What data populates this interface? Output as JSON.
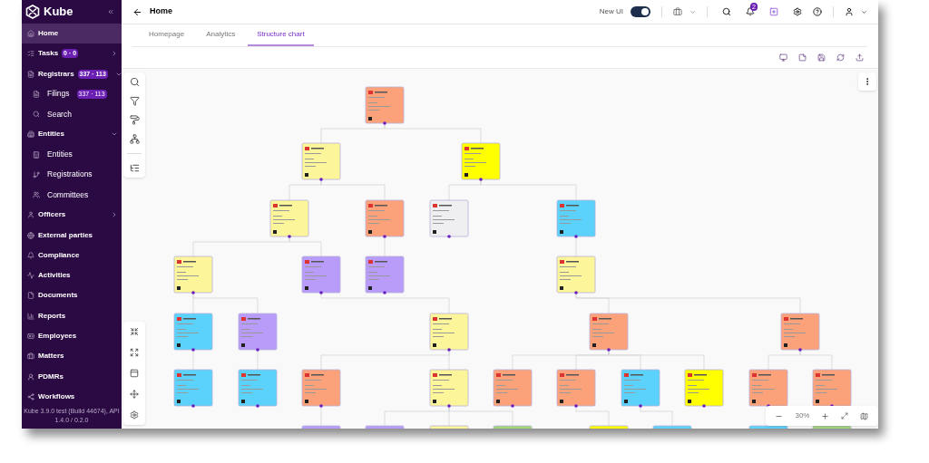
{
  "sidebar": {
    "logo": "Kube",
    "items": [
      {
        "label": "Home",
        "selected": true
      },
      {
        "label": "Tasks",
        "badge": "0 · 0",
        "expanded": false
      },
      {
        "label": "Registrars",
        "badge": "337 · 113",
        "expanded": true,
        "children": [
          {
            "label": "Filings",
            "badge": "337 · 113"
          },
          {
            "label": "Search"
          }
        ]
      },
      {
        "label": "Entities",
        "expanded": true,
        "children": [
          {
            "label": "Entities"
          },
          {
            "label": "Registrations"
          },
          {
            "label": "Committees"
          }
        ]
      },
      {
        "label": "Officers",
        "expanded": false
      },
      {
        "label": "External parties"
      },
      {
        "label": "Compliance"
      },
      {
        "label": "Activities"
      },
      {
        "label": "Documents"
      },
      {
        "label": "Reports"
      },
      {
        "label": "Employees"
      },
      {
        "label": "Matters"
      },
      {
        "label": "PDMRs"
      },
      {
        "label": "Workflows"
      }
    ],
    "footer": "Kube 3.9.0 test (Build 44674), API 1.4.0 / 0.2.0"
  },
  "header": {
    "title": "Home",
    "new_ui": {
      "label": "New UI",
      "on": true
    },
    "notification_count": "2"
  },
  "tabs": [
    {
      "label": "Homepage",
      "selected": false
    },
    {
      "label": "Analytics",
      "selected": false
    },
    {
      "label": "Structure chart",
      "selected": true
    }
  ],
  "chart": {
    "zoom": "30%",
    "nodes": [
      {
        "color": "#fca27a"
      },
      {
        "color": "#fdf59a"
      },
      {
        "color": "#ffff00"
      },
      {
        "color": "#fdf59a"
      },
      {
        "color": "#fca27a"
      },
      {
        "color": "#efeef0"
      },
      {
        "color": "#5ad2fb"
      },
      {
        "color": "#fdf59a"
      },
      {
        "color": "#b99cfa"
      },
      {
        "color": "#b99cfa"
      },
      {
        "color": "#fdf59a"
      },
      {
        "color": "#5ad2fb"
      },
      {
        "color": "#b99cfa"
      },
      {
        "color": "#fdf59a"
      },
      {
        "color": "#fca27a"
      },
      {
        "color": "#fca27a"
      },
      {
        "color": "#5ad2fb"
      },
      {
        "color": "#5ad2fb"
      },
      {
        "color": "#fca27a"
      },
      {
        "color": "#fdf59a"
      },
      {
        "color": "#fca27a"
      },
      {
        "color": "#fca27a"
      },
      {
        "color": "#5ad2fb"
      },
      {
        "color": "#ffff00"
      },
      {
        "color": "#fca27a"
      },
      {
        "color": "#fca27a"
      },
      {
        "color": "#b99cfa"
      },
      {
        "color": "#b99cfa"
      },
      {
        "color": "#fdf59a"
      },
      {
        "color": "#a3d67c"
      },
      {
        "color": "#ffff00"
      },
      {
        "color": "#5ad2fb"
      },
      {
        "color": "#5ad2fb"
      },
      {
        "color": "#a3d67c"
      }
    ]
  }
}
